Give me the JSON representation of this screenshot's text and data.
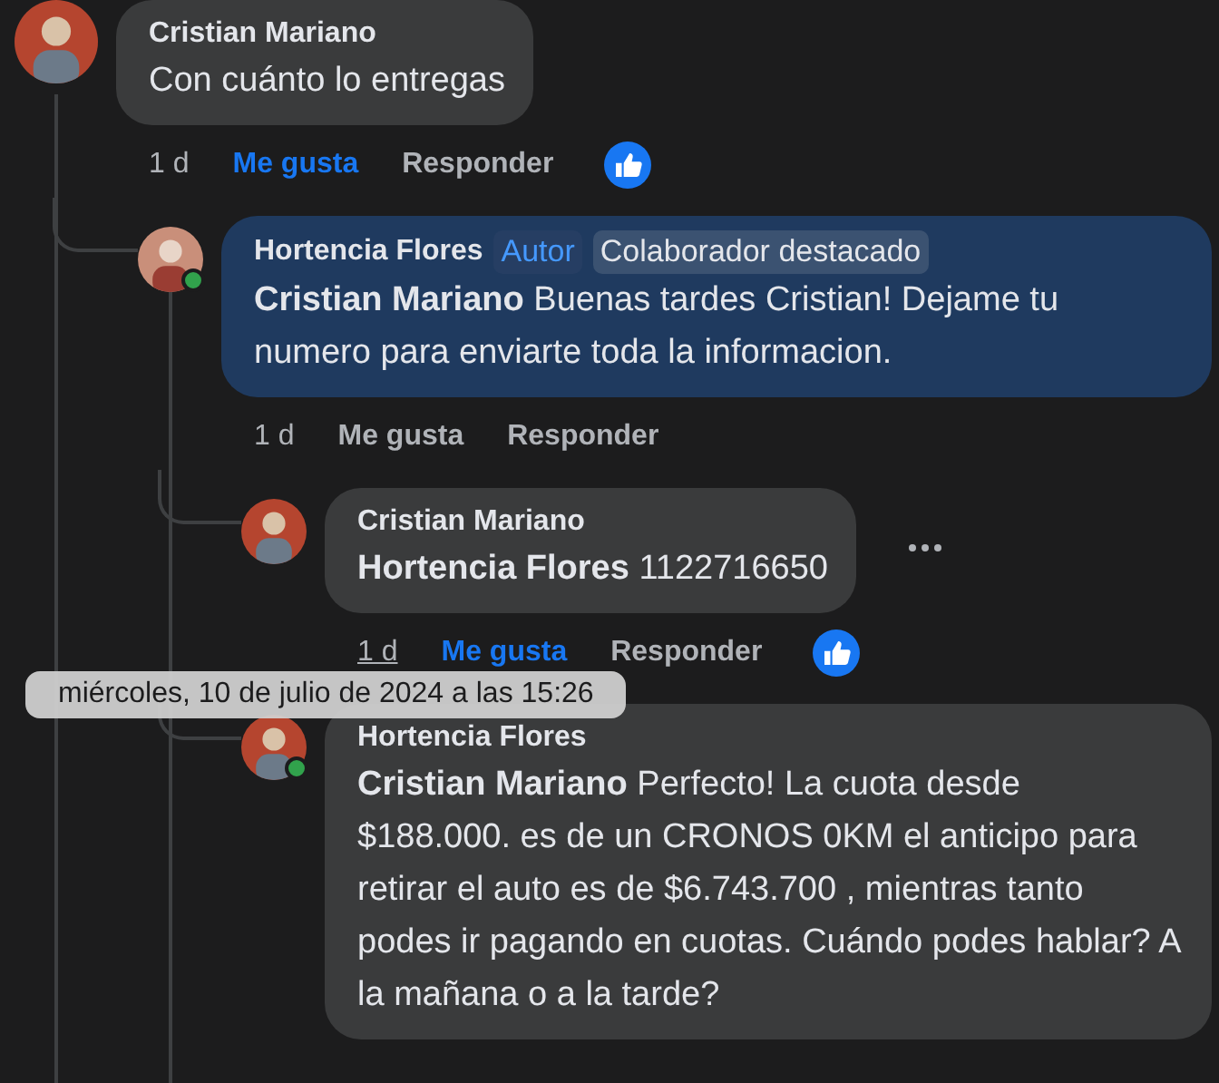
{
  "comments": [
    {
      "author": "Cristian Mariano",
      "online": false,
      "highlighted": false,
      "text": "Con cuánto lo entregas",
      "time": "1 d",
      "time_hovered": false,
      "like_label": "Me gusta",
      "liked": true,
      "reply_label": "Responder",
      "reacted": true,
      "children": [
        {
          "author": "Hortencia Flores",
          "online": true,
          "highlighted": true,
          "tags": [
            {
              "label": "Autor",
              "kind": "author"
            },
            {
              "label": "Colaborador destacado",
              "kind": "badge"
            }
          ],
          "text": "**Cristian Mariano** Buenas tardes Cristian! Dejame tu numero para enviarte toda la informacion.",
          "time": "1 d",
          "time_hovered": false,
          "like_label": "Me gusta",
          "liked": false,
          "reply_label": "Responder",
          "reacted": false,
          "children": [
            {
              "author": "Cristian Mariano",
              "online": false,
              "highlighted": false,
              "text": "**Hortencia Flores** 1122716650",
              "time": "1 d",
              "time_hovered": true,
              "tooltip": "miércoles, 10 de julio de 2024 a las 15:26",
              "like_label": "Me gusta",
              "liked": true,
              "reply_label": "Responder",
              "reacted": true,
              "more_button": true
            },
            {
              "author": "Hortencia Flores",
              "online": true,
              "highlighted": false,
              "text": "**Cristian Mariano** Perfecto! La cuota desde $188.000. es de un CRONOS 0KM el anticipo para retirar el auto es de $6.743.700 , mientras tanto podes ir pagando en cuotas. Cuándo podes hablar? A la mañana o a la tarde?"
            }
          ]
        }
      ]
    }
  ]
}
